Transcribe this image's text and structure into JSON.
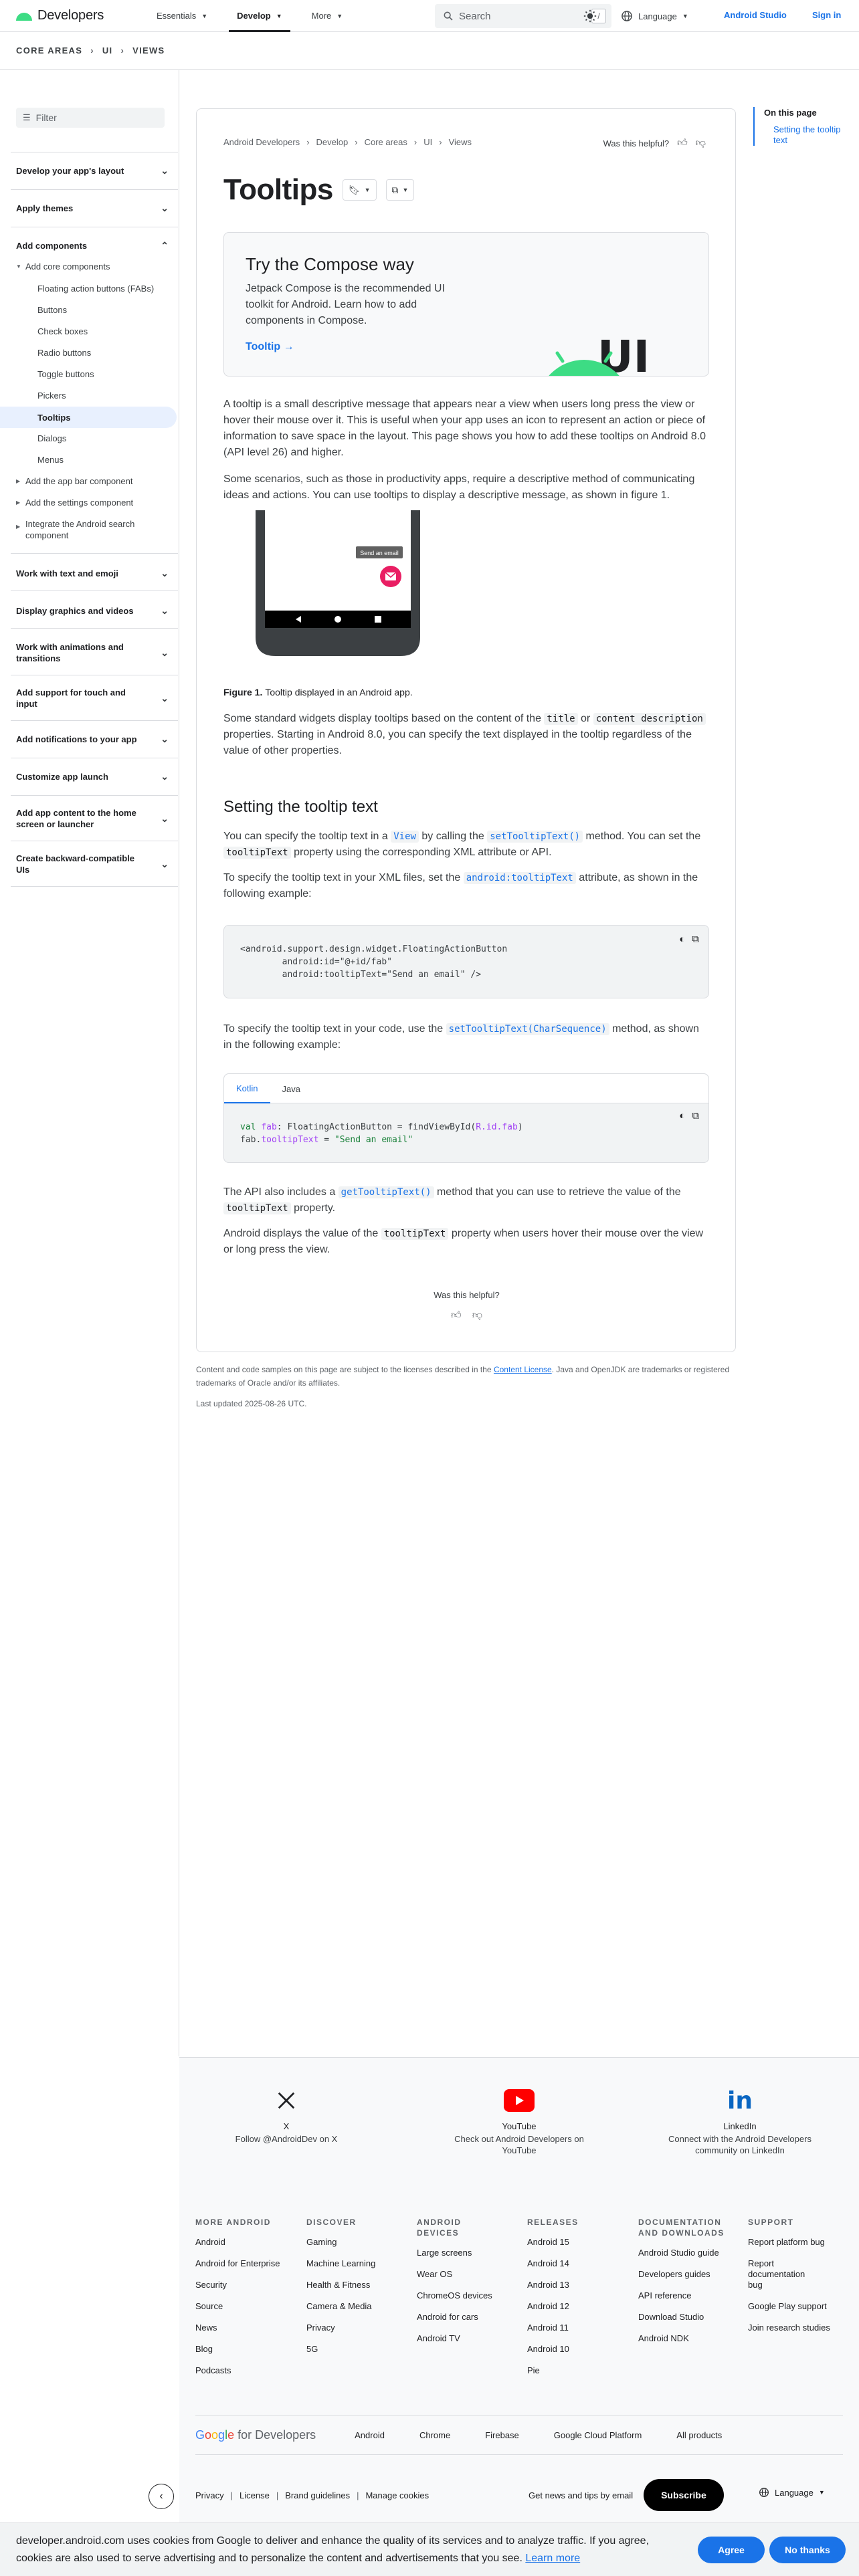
{
  "header": {
    "logo": "Developers",
    "nav": [
      {
        "label": "Essentials"
      },
      {
        "label": "Develop"
      },
      {
        "label": "More"
      }
    ],
    "search_placeholder": "Search",
    "search_shortcut": "/",
    "language": "Language",
    "android_studio": "Android Studio",
    "sign_in": "Sign in"
  },
  "breadcrumb_band": {
    "a": "CORE AREAS",
    "b": "UI",
    "c": "VIEWS"
  },
  "sidebar": {
    "filter_placeholder": "Filter",
    "sections": [
      "Develop your app's layout",
      "Apply themes",
      "Add components",
      "Work with text and emoji",
      "Display graphics and videos",
      "Work with animations and transitions",
      "Add support for touch and input",
      "Add notifications to your app",
      "Customize app launch",
      "Add app content to the home screen or launcher",
      "Create backward-compatible UIs"
    ],
    "add_core": "Add core components",
    "core_items": [
      "Floating action buttons (FABs)",
      "Buttons",
      "Check boxes",
      "Radio buttons",
      "Toggle buttons",
      "Pickers",
      "Tooltips",
      "Dialogs",
      "Menus"
    ],
    "sub_items": [
      "Add the app bar component",
      "Add the settings component",
      "Integrate the Android search component"
    ]
  },
  "toc": {
    "title": "On this page",
    "items": [
      "Setting the tooltip text"
    ]
  },
  "article": {
    "crumbs": [
      "Android Developers",
      "Develop",
      "Core areas",
      "UI",
      "Views"
    ],
    "helpful": "Was this helpful?",
    "title": "Tooltips",
    "compose": {
      "title": "Try the Compose way",
      "text": "Jetpack Compose is the recommended UI toolkit for Android. Learn how to add components in Compose.",
      "link": "Tooltip →",
      "badge": "UI"
    },
    "p1": "A tooltip is a small descriptive message that appears near a view when users long press the view or hover their mouse over it. This is useful when your app uses an icon to represent an action or piece of information to save space in the layout. This page shows you how to add these tooltips on Android 8.0 (API level 26) and higher.",
    "p2": "Some scenarios, such as those in productivity apps, require a descriptive method of communicating ideas and actions. You can use tooltips to display a descriptive message, as shown in figure 1.",
    "figure_tooltip": "Send an email",
    "caption_label": "Figure 1.",
    "caption_text": "Tooltip displayed in an Android app.",
    "p3": {
      "a": "Some standard widgets display tooltips based on the content of the ",
      "c1": "title",
      "b": " or ",
      "c2": "content description",
      "c": " properties. Starting in Android 8.0, you can specify the text displayed in the tooltip regardless of the value of other properties."
    },
    "h2": "Setting the tooltip text",
    "p4": {
      "a": "You can specify the tooltip text in a ",
      "c1": "View",
      "b": " by calling the ",
      "c2": "setTooltipText()",
      "c": " method. You can set the ",
      "c3": "tooltipText",
      "d": " property using the corresponding XML attribute or API."
    },
    "p5": {
      "a": "To specify the tooltip text in your XML files, set the ",
      "c1": "android:tooltipText",
      "b": " attribute, as shown in the following example:"
    },
    "xml_code": {
      "l1": "<android.support.design.widget.FloatingActionButton",
      "l2": "        android:id=\"@+id/fab\"",
      "l3": "        android:tooltipText=\"Send an email\" />"
    },
    "p6": {
      "a": "To specify the tooltip text in your code, use the ",
      "c1": "setTooltipText(CharSequence)",
      "b": " method, as shown in the following example:"
    },
    "tabs": [
      "Kotlin",
      "Java"
    ],
    "kotlin_code": {
      "val": "val",
      "fab": "fab",
      "type": ": FloatingActionButton = findViewById(",
      "ref": "R.id.fab",
      "close": ")",
      "line2a": "fab.",
      "line2b": "tooltipText",
      "line2c": " = ",
      "line2d": "\"Send an email\""
    },
    "p7": {
      "a": "The API also includes a ",
      "c1": "getTooltipText()",
      "b": " method that you can use to retrieve the value of the ",
      "c2": "tooltipText",
      "c": " property."
    },
    "p8": {
      "a": "Android displays the value of the ",
      "c1": "tooltipText",
      "b": " property when users hover their mouse over the view or long press the view."
    },
    "helpful_bottom": "Was this helpful?"
  },
  "license": {
    "a": "Content and code samples on this page are subject to the licenses described in the ",
    "link": "Content License",
    "b": ". Java and OpenJDK are trademarks or registered trademarks of Oracle and/or its affiliates."
  },
  "updated": "Last updated 2025-08-26 UTC.",
  "footer": {
    "social": [
      {
        "name": "X",
        "desc": "Follow @AndroidDev on X"
      },
      {
        "name": "YouTube",
        "desc": "Check out Android Developers on YouTube"
      },
      {
        "name": "LinkedIn",
        "desc": "Connect with the Android Developers community on LinkedIn"
      }
    ],
    "columns": [
      {
        "title": "MORE ANDROID",
        "links": [
          "Android",
          "Android for Enterprise",
          "Security",
          "Source",
          "News",
          "Blog",
          "Podcasts"
        ]
      },
      {
        "title": "DISCOVER",
        "links": [
          "Gaming",
          "Machine Learning",
          "Health & Fitness",
          "Camera & Media",
          "Privacy",
          "5G"
        ]
      },
      {
        "title": "ANDROID DEVICES",
        "links": [
          "Large screens",
          "Wear OS",
          "ChromeOS devices",
          "Android for cars",
          "Android TV"
        ]
      },
      {
        "title": "RELEASES",
        "links": [
          "Android 15",
          "Android 14",
          "Android 13",
          "Android 12",
          "Android 11",
          "Android 10",
          "Pie"
        ]
      },
      {
        "title": "DOCUMENTATION AND DOWNLOADS",
        "links": [
          "Android Studio guide",
          "Developers guides",
          "API reference",
          "Download Studio",
          "Android NDK"
        ]
      },
      {
        "title": "SUPPORT",
        "links": [
          "Report platform bug",
          "Report documentation bug",
          "Google Play support",
          "Join research studies"
        ]
      }
    ],
    "gfd_links": [
      "Android",
      "Chrome",
      "Firebase",
      "Google Cloud Platform",
      "All products"
    ],
    "bottom_links": [
      "Privacy",
      "License",
      "Brand guidelines",
      "Manage cookies"
    ],
    "news": "Get news and tips by email",
    "subscribe": "Subscribe",
    "language": "Language"
  },
  "cookie": {
    "text": "developer.android.com uses cookies from Google to deliver and enhance the quality of its services and to analyze traffic. If you agree, cookies are also used to serve advertising and to personalize the content and advertisements that you see. ",
    "link": "Learn more",
    "agree": "Agree",
    "no": "No thanks"
  },
  "colors": {
    "accent": "#1a73e8",
    "android_green": "#3ddc84",
    "fab_pink": "#e91e63"
  }
}
